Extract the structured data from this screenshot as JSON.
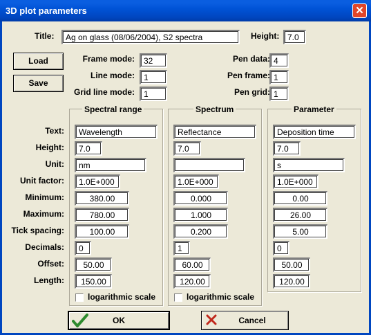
{
  "window": {
    "title": "3D plot parameters"
  },
  "header": {
    "title_label": "Title:",
    "title_value": "Ag on glass (08/06/2004), S2 spectra",
    "height_label": "Height:",
    "height_value": "7.0"
  },
  "buttons": {
    "load": "Load",
    "save": "Save",
    "ok": "OK",
    "cancel": "Cancel"
  },
  "modes": {
    "frame_mode_label": "Frame mode:",
    "frame_mode": "32",
    "line_mode_label": "Line mode:",
    "line_mode": "1",
    "grid_line_mode_label": "Grid line mode:",
    "grid_line_mode": "1",
    "pen_data_label": "Pen data:",
    "pen_data": "4",
    "pen_frame_label": "Pen frame:",
    "pen_frame": "1",
    "pen_grid_label": "Pen grid:",
    "pen_grid": "1"
  },
  "row_labels": {
    "text": "Text:",
    "height": "Height:",
    "unit": "Unit:",
    "unit_factor": "Unit factor:",
    "minimum": "Minimum:",
    "maximum": "Maximum:",
    "tick_spacing": "Tick spacing:",
    "decimals": "Decimals:",
    "offset": "Offset:",
    "length": "Length:"
  },
  "axes": [
    {
      "title": "Spectral range",
      "text": "Wavelength",
      "height": "7.0",
      "unit": "nm",
      "unit_factor": "1.0E+000",
      "minimum": "380.00",
      "maximum": "780.00",
      "tick_spacing": "100.00",
      "decimals": "0",
      "offset": "50.00",
      "length": "150.00",
      "log_label": "logarithmic scale",
      "log_checked": false
    },
    {
      "title": "Spectrum",
      "text": "Reflectance",
      "height": "7.0",
      "unit": "",
      "unit_factor": "1.0E+000",
      "minimum": "0.000",
      "maximum": "1.000",
      "tick_spacing": "0.200",
      "decimals": "1",
      "offset": "60.00",
      "length": "120.00",
      "log_label": "logarithmic scale",
      "log_checked": false
    },
    {
      "title": "Parameter",
      "text": "Deposition time",
      "height": "7.0",
      "unit": "s",
      "unit_factor": "1.0E+000",
      "minimum": "0.00",
      "maximum": "26.00",
      "tick_spacing": "5.00",
      "decimals": "0",
      "offset": "50.00",
      "length": "120.00"
    }
  ],
  "colors": {
    "titlebar": "#0046c0",
    "dialog_bg": "#ece9d8",
    "ok_check": "#2e8b2e",
    "cancel_x": "#c0281c"
  },
  "icons": {
    "ok": "check-icon",
    "cancel": "x-icon",
    "close": "close-icon"
  }
}
